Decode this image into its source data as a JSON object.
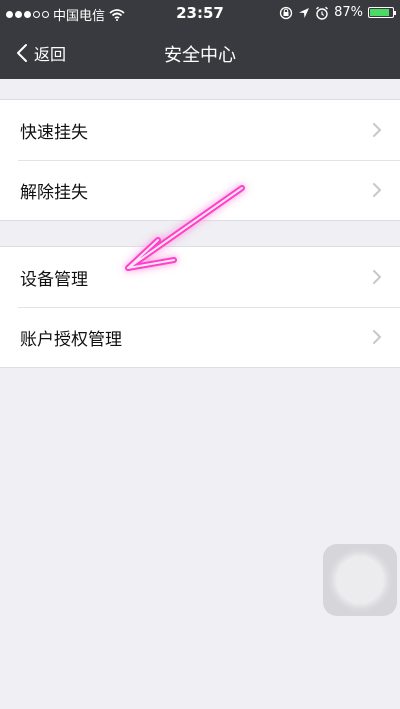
{
  "status_bar": {
    "carrier": "中国电信",
    "time": "23:57",
    "battery": "87%",
    "battery_level": 0.87,
    "icons": [
      "signal-dots-icon",
      "wifi-icon",
      "lock-rotation-icon",
      "location-icon",
      "alarm-icon",
      "battery-icon"
    ]
  },
  "nav": {
    "back_label": "返回",
    "title": "安全中心"
  },
  "groups": [
    {
      "items": [
        {
          "label": "快速挂失"
        },
        {
          "label": "解除挂失"
        }
      ]
    },
    {
      "items": [
        {
          "label": "设备管理"
        },
        {
          "label": "账户授权管理"
        }
      ]
    }
  ],
  "colors": {
    "header_bg": "#393a3f",
    "page_bg": "#efeff4",
    "battery_green": "#4cd964",
    "annotation_pink": "#ff40c8"
  }
}
